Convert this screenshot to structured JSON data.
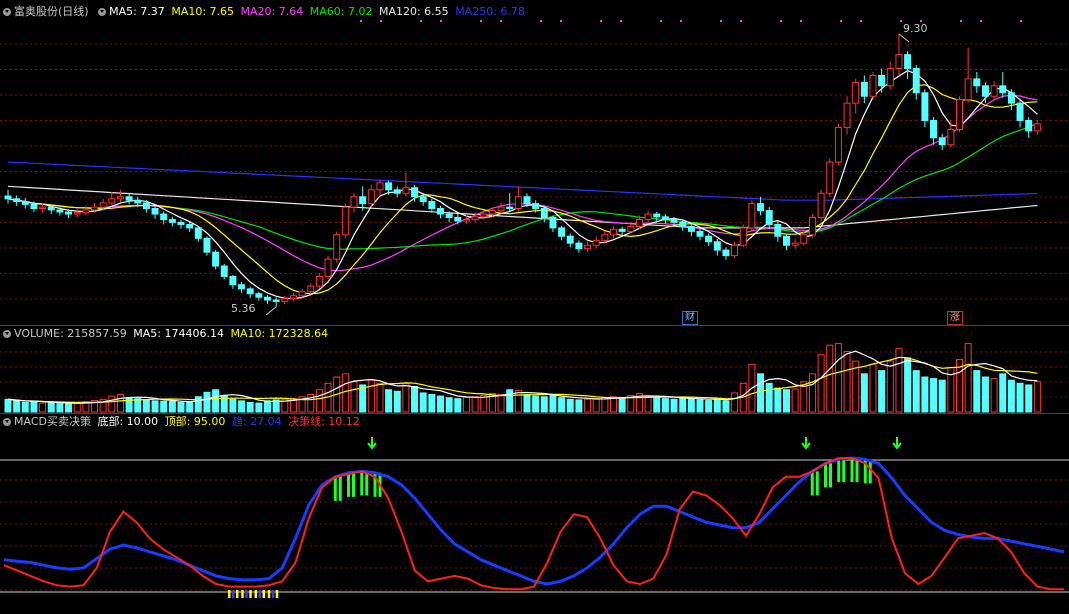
{
  "colors": {
    "up": "#ff3232",
    "down": "#54ffff",
    "ma5": "#ffffff",
    "ma10": "#ffff00",
    "ma20": "#ff40ff",
    "ma60": "#00e600",
    "ma120": "#e8e8e8",
    "ma250": "#3030ff",
    "grid": "#7a1010",
    "macd_red": "#ff2020",
    "macd_blue": "#1a3cff",
    "hist_green": "#22ff22",
    "hist_yellow": "#ffff00",
    "hist_blue": "#3a3aff",
    "arrow": "#22ff22"
  },
  "price_panel": {
    "stock_name": "富奥股份(日线)",
    "ma5": {
      "label": "MA5: 7.37"
    },
    "ma10": {
      "label": "MA10: 7.65"
    },
    "ma20": {
      "label": "MA20: 7.64"
    },
    "ma60": {
      "label": "MA60: 7.02"
    },
    "ma120": {
      "label": "MA120: 6.55"
    },
    "ma250": {
      "label": "MA250: 6.78"
    },
    "high_marker": "9.30",
    "low_marker": "5.36",
    "badge_cai": "财",
    "badge_zhang": "涨"
  },
  "volume_panel": {
    "title": "VOLUME: 215857.59",
    "ma5": "MA5: 174406.14",
    "ma10": "MA10: 172328.64"
  },
  "macd_panel": {
    "title": "MACD买卖决策",
    "bottom": "底部: 10.00",
    "top": "顶部: 95.00",
    "trend": "趋: 27.04",
    "decision": "决策线: 10.12"
  },
  "chart_data": {
    "type": "candlestick",
    "price_range": [
      5.2,
      9.5
    ],
    "candles": [
      [
        6.96,
        6.92,
        7.05,
        6.85
      ],
      [
        6.92,
        6.88,
        6.97,
        6.82
      ],
      [
        6.88,
        6.84,
        6.93,
        6.78
      ],
      [
        6.84,
        6.78,
        6.88,
        6.73
      ],
      [
        6.78,
        6.8,
        6.85,
        6.72
      ],
      [
        6.8,
        6.76,
        6.83,
        6.7
      ],
      [
        6.76,
        6.73,
        6.8,
        6.68
      ],
      [
        6.73,
        6.7,
        6.77,
        6.64
      ],
      [
        6.7,
        6.72,
        6.77,
        6.65
      ],
      [
        6.72,
        6.76,
        6.82,
        6.68
      ],
      [
        6.76,
        6.8,
        6.86,
        6.72
      ],
      [
        6.8,
        6.86,
        6.92,
        6.76
      ],
      [
        6.86,
        6.92,
        7.02,
        6.82
      ],
      [
        6.92,
        6.95,
        7.05,
        6.87
      ],
      [
        6.95,
        6.9,
        7.0,
        6.84
      ],
      [
        6.9,
        6.86,
        6.95,
        6.8
      ],
      [
        6.86,
        6.78,
        6.9,
        6.72
      ],
      [
        6.78,
        6.7,
        6.82,
        6.63
      ],
      [
        6.7,
        6.62,
        6.74,
        6.55
      ],
      [
        6.62,
        6.58,
        6.66,
        6.52
      ],
      [
        6.58,
        6.55,
        6.62,
        6.49
      ],
      [
        6.55,
        6.5,
        6.58,
        6.44
      ],
      [
        6.5,
        6.35,
        6.52,
        6.3
      ],
      [
        6.35,
        6.15,
        6.38,
        6.1
      ],
      [
        6.15,
        5.95,
        6.18,
        5.9
      ],
      [
        5.95,
        5.8,
        5.98,
        5.76
      ],
      [
        5.8,
        5.68,
        5.82,
        5.62
      ],
      [
        5.68,
        5.62,
        5.72,
        5.56
      ],
      [
        5.62,
        5.55,
        5.65,
        5.49
      ],
      [
        5.55,
        5.5,
        5.58,
        5.45
      ],
      [
        5.5,
        5.46,
        5.53,
        5.4
      ],
      [
        5.46,
        5.44,
        5.5,
        5.36
      ],
      [
        5.44,
        5.48,
        5.52,
        5.4
      ],
      [
        5.48,
        5.52,
        5.56,
        5.44
      ],
      [
        5.52,
        5.58,
        5.62,
        5.48
      ],
      [
        5.58,
        5.66,
        5.7,
        5.54
      ],
      [
        5.66,
        5.8,
        5.85,
        5.62
      ],
      [
        5.8,
        6.05,
        6.1,
        5.76
      ],
      [
        6.05,
        6.4,
        6.45,
        6.0
      ],
      [
        6.4,
        6.8,
        6.85,
        6.35
      ],
      [
        6.8,
        6.95,
        7.0,
        6.72
      ],
      [
        6.95,
        6.85,
        7.1,
        6.75
      ],
      [
        6.85,
        7.05,
        7.12,
        6.8
      ],
      [
        7.05,
        7.15,
        7.2,
        6.95
      ],
      [
        7.15,
        7.05,
        7.18,
        6.98
      ],
      [
        7.05,
        7.0,
        7.1,
        6.94
      ],
      [
        7.0,
        7.08,
        7.3,
        6.96
      ],
      [
        7.08,
        6.95,
        7.12,
        6.88
      ],
      [
        6.95,
        6.88,
        7.0,
        6.82
      ],
      [
        6.88,
        6.78,
        6.92,
        6.72
      ],
      [
        6.78,
        6.7,
        6.82,
        6.64
      ],
      [
        6.7,
        6.65,
        6.74,
        6.58
      ],
      [
        6.65,
        6.6,
        6.7,
        6.55
      ],
      [
        6.6,
        6.62,
        6.68,
        6.56
      ],
      [
        6.62,
        6.66,
        6.72,
        6.58
      ],
      [
        6.66,
        6.7,
        6.75,
        6.62
      ],
      [
        6.7,
        6.75,
        6.8,
        6.66
      ],
      [
        6.75,
        6.8,
        6.86,
        6.7
      ],
      [
        6.8,
        6.78,
        7.0,
        6.74
      ],
      [
        6.78,
        6.95,
        7.1,
        6.74
      ],
      [
        6.95,
        6.85,
        7.0,
        6.8
      ],
      [
        6.85,
        6.78,
        6.9,
        6.72
      ],
      [
        6.78,
        6.65,
        6.82,
        6.58
      ],
      [
        6.65,
        6.5,
        6.68,
        6.44
      ],
      [
        6.5,
        6.38,
        6.53,
        6.32
      ],
      [
        6.38,
        6.28,
        6.42,
        6.22
      ],
      [
        6.28,
        6.2,
        6.32,
        6.14
      ],
      [
        6.2,
        6.25,
        6.3,
        6.15
      ],
      [
        6.25,
        6.32,
        6.38,
        6.2
      ],
      [
        6.32,
        6.4,
        6.46,
        6.28
      ],
      [
        6.4,
        6.48,
        6.53,
        6.35
      ],
      [
        6.48,
        6.45,
        6.52,
        6.4
      ],
      [
        6.45,
        6.52,
        6.58,
        6.42
      ],
      [
        6.52,
        6.62,
        6.68,
        6.48
      ],
      [
        6.62,
        6.7,
        6.75,
        6.58
      ],
      [
        6.7,
        6.66,
        6.73,
        6.6
      ],
      [
        6.66,
        6.62,
        6.7,
        6.56
      ],
      [
        6.62,
        6.58,
        6.66,
        6.52
      ],
      [
        6.58,
        6.52,
        6.62,
        6.46
      ],
      [
        6.52,
        6.45,
        6.56,
        6.38
      ],
      [
        6.45,
        6.38,
        6.5,
        6.32
      ],
      [
        6.38,
        6.3,
        6.42,
        6.24
      ],
      [
        6.3,
        6.18,
        6.34,
        6.1
      ],
      [
        6.18,
        6.1,
        6.22,
        6.04
      ],
      [
        6.1,
        6.25,
        6.3,
        6.06
      ],
      [
        6.25,
        6.5,
        6.55,
        6.22
      ],
      [
        6.5,
        6.85,
        6.9,
        6.46
      ],
      [
        6.85,
        6.75,
        6.95,
        6.68
      ],
      [
        6.75,
        6.55,
        6.8,
        6.48
      ],
      [
        6.55,
        6.38,
        6.6,
        6.3
      ],
      [
        6.38,
        6.25,
        6.42,
        6.18
      ],
      [
        6.25,
        6.28,
        6.34,
        6.2
      ],
      [
        6.28,
        6.4,
        6.46,
        6.24
      ],
      [
        6.4,
        6.65,
        6.7,
        6.36
      ],
      [
        6.65,
        7.0,
        7.05,
        6.6
      ],
      [
        7.0,
        7.45,
        7.5,
        6.95
      ],
      [
        7.45,
        7.95,
        8.0,
        7.4
      ],
      [
        7.95,
        8.3,
        8.4,
        7.85
      ],
      [
        8.3,
        8.6,
        8.65,
        8.15
      ],
      [
        8.6,
        8.4,
        8.7,
        8.3
      ],
      [
        8.4,
        8.7,
        8.75,
        8.35
      ],
      [
        8.7,
        8.55,
        8.8,
        8.45
      ],
      [
        8.55,
        8.8,
        8.9,
        8.5
      ],
      [
        8.8,
        9.0,
        9.3,
        8.7
      ],
      [
        9.0,
        8.8,
        9.05,
        8.65
      ],
      [
        8.8,
        8.45,
        8.85,
        8.35
      ],
      [
        8.45,
        8.05,
        8.5,
        7.95
      ],
      [
        8.05,
        7.8,
        8.1,
        7.7
      ],
      [
        7.8,
        7.7,
        7.86,
        7.62
      ],
      [
        7.7,
        7.92,
        8.05,
        7.66
      ],
      [
        7.92,
        8.35,
        8.4,
        7.88
      ],
      [
        8.35,
        8.65,
        9.1,
        8.3
      ],
      [
        8.65,
        8.55,
        8.75,
        8.45
      ],
      [
        8.55,
        8.4,
        8.6,
        8.3
      ],
      [
        8.4,
        8.55,
        8.62,
        8.34
      ],
      [
        8.55,
        8.45,
        8.75,
        8.38
      ],
      [
        8.45,
        8.3,
        8.5,
        8.2
      ],
      [
        8.3,
        8.05,
        8.35,
        7.95
      ],
      [
        8.05,
        7.9,
        8.1,
        7.8
      ],
      [
        7.9,
        8.0,
        8.06,
        7.84
      ]
    ],
    "volume_range": [
      0,
      220000
    ],
    "volumes": [
      40000,
      35000,
      30000,
      32000,
      28000,
      30000,
      26000,
      25000,
      28000,
      32000,
      36000,
      40000,
      50000,
      55000,
      45000,
      42000,
      38000,
      35000,
      34000,
      33000,
      30000,
      30000,
      48000,
      62000,
      70000,
      52000,
      40000,
      35000,
      30000,
      28000,
      35000,
      38000,
      40000,
      42000,
      48000,
      55000,
      70000,
      90000,
      110000,
      120000,
      95000,
      85000,
      100000,
      90000,
      70000,
      65000,
      90000,
      80000,
      60000,
      55000,
      50000,
      45000,
      42000,
      46000,
      48000,
      52000,
      58000,
      55000,
      70000,
      68000,
      55000,
      50000,
      48000,
      52000,
      45000,
      40000,
      38000,
      40000,
      42000,
      46000,
      48000,
      45000,
      52000,
      58000,
      50000,
      45000,
      42000,
      40000,
      45000,
      42000,
      38000,
      36000,
      40000,
      35000,
      60000,
      90000,
      150000,
      120000,
      90000,
      75000,
      70000,
      72000,
      95000,
      120000,
      180000,
      210000,
      215000,
      190000,
      160000,
      120000,
      150000,
      130000,
      160000,
      200000,
      170000,
      130000,
      110000,
      105000,
      100000,
      140000,
      165000,
      215000,
      130000,
      110000,
      105000,
      120000,
      100000,
      90000,
      85000,
      95000
    ],
    "macd_red": [
      20,
      16,
      12,
      8,
      5,
      4,
      5,
      18,
      45,
      60,
      52,
      40,
      32,
      26,
      20,
      12,
      6,
      4,
      4,
      4,
      5,
      8,
      22,
      55,
      78,
      86,
      88,
      90,
      86,
      70,
      45,
      16,
      8,
      10,
      12,
      10,
      5,
      3,
      2,
      2,
      4,
      22,
      45,
      58,
      56,
      40,
      20,
      8,
      6,
      10,
      28,
      62,
      75,
      72,
      65,
      55,
      42,
      58,
      78,
      86,
      86,
      90,
      96,
      100,
      100,
      96,
      85,
      40,
      14,
      6,
      12,
      26,
      40,
      42,
      44,
      40,
      30,
      14,
      4,
      2,
      2
    ],
    "macd_blue": [
      24,
      23,
      22,
      20,
      18,
      17,
      18,
      25,
      32,
      35,
      33,
      30,
      27,
      24,
      20,
      16,
      12,
      10,
      9,
      9,
      10,
      18,
      40,
      65,
      80,
      86,
      89,
      90,
      89,
      86,
      80,
      70,
      58,
      46,
      36,
      30,
      24,
      20,
      16,
      12,
      8,
      6,
      8,
      12,
      18,
      26,
      36,
      48,
      58,
      64,
      64,
      60,
      56,
      52,
      50,
      48,
      48,
      52,
      62,
      72,
      82,
      90,
      96,
      99,
      100,
      99,
      96,
      85,
      72,
      62,
      52,
      46,
      43,
      41,
      40,
      40,
      38,
      36,
      34,
      32,
      30
    ],
    "macd_range": [
      0,
      100
    ]
  }
}
